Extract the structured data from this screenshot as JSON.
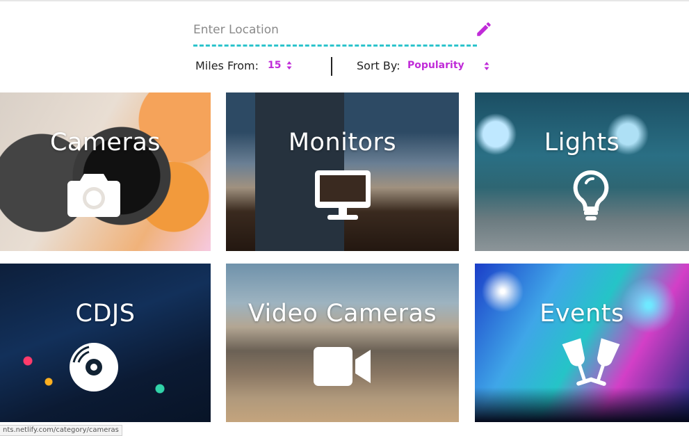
{
  "search": {
    "placeholder": "Enter Location"
  },
  "filters": {
    "miles_label": "Miles From:",
    "miles_value": "15",
    "sort_label": "Sort By:",
    "sort_value": "Popularity"
  },
  "categories": [
    {
      "title": "Cameras",
      "icon": "camera-icon"
    },
    {
      "title": "Monitors",
      "icon": "monitor-icon"
    },
    {
      "title": "Lights",
      "icon": "lightbulb-icon"
    },
    {
      "title": "CDJS",
      "icon": "disc-icon"
    },
    {
      "title": "Video Cameras",
      "icon": "video-camera-icon"
    },
    {
      "title": "Events",
      "icon": "cheers-icon"
    }
  ],
  "status_bar": {
    "url": "nts.netlify.com/category/cameras"
  },
  "colors": {
    "accent": "#c02bd8",
    "input_underline": "#2ec4cc"
  }
}
